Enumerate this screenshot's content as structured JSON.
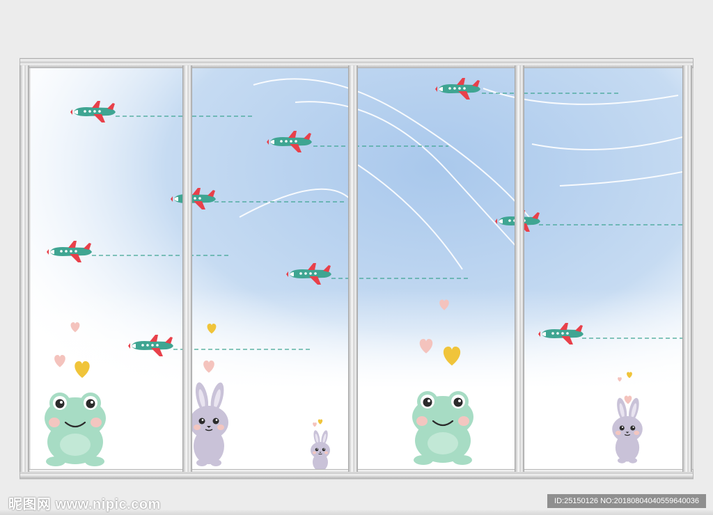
{
  "watermark": {
    "site": "昵图网 www.nipic.com",
    "id_text": "ID:25150126 NO:20180804040559640036"
  },
  "colors": {
    "sky": "#a9c8ec",
    "plane_body": "#3fa592",
    "plane_accent": "#e8404a",
    "frog": "#a7dcc4",
    "bunny": "#c9c2d8",
    "heart_yellow": "#f0c43a",
    "heart_pink": "#f4c3bd",
    "frame": "#d6d6d6"
  },
  "illustration": {
    "subjects": [
      "airplane",
      "airplane",
      "airplane",
      "airplane",
      "airplane",
      "airplane",
      "airplane",
      "airplane",
      "airplane",
      "frog",
      "frog",
      "bunny",
      "bunny",
      "bunny"
    ]
  }
}
